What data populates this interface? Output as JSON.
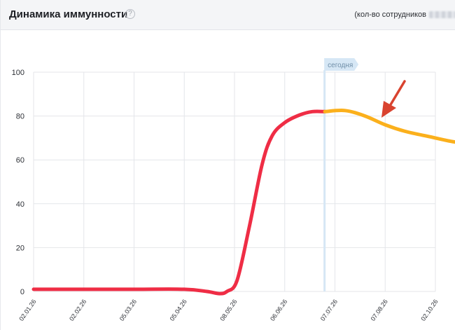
{
  "header": {
    "title": "Динамика иммунности",
    "help_icon": "?",
    "employees_label": "(кол-во сотрудников",
    "employees_count_state": "blurred"
  },
  "chart_data": {
    "type": "line",
    "title": "",
    "xlabel": "",
    "ylabel": "",
    "x_tick_labels": [
      "02.01.26",
      "02.02.26",
      "05.03.26",
      "05.04.26",
      "08.05.26",
      "06.06.26",
      "07.07.26",
      "07.08.26",
      "02.10.26"
    ],
    "ylim": [
      0,
      100
    ],
    "y_ticks": [
      "0",
      "20",
      "40",
      "60",
      "80",
      "100"
    ],
    "grid": true,
    "today_marker": {
      "label": "сегодня",
      "x": 5.8
    },
    "series": [
      {
        "segment": "actual",
        "color": "#ef2d45",
        "points": [
          [
            0,
            1
          ],
          [
            1,
            1
          ],
          [
            2,
            1
          ],
          [
            3,
            1
          ],
          [
            3.45,
            0
          ],
          [
            3.7,
            -1
          ],
          [
            3.85,
            0
          ],
          [
            4.05,
            5
          ],
          [
            4.3,
            30
          ],
          [
            4.55,
            58
          ],
          [
            4.75,
            71
          ],
          [
            5.0,
            77
          ],
          [
            5.3,
            80.5
          ],
          [
            5.55,
            82
          ],
          [
            5.8,
            82
          ]
        ]
      },
      {
        "segment": "forecast",
        "color": "#fbb01c",
        "points": [
          [
            5.8,
            82
          ],
          [
            6.2,
            82.5
          ],
          [
            6.6,
            80
          ],
          [
            7.0,
            76
          ],
          [
            7.4,
            73
          ],
          [
            7.9,
            70.5
          ],
          [
            8.3,
            68.5
          ],
          [
            8.6,
            67.5
          ]
        ]
      }
    ],
    "annotation_arrow_color": "#d9432f"
  }
}
